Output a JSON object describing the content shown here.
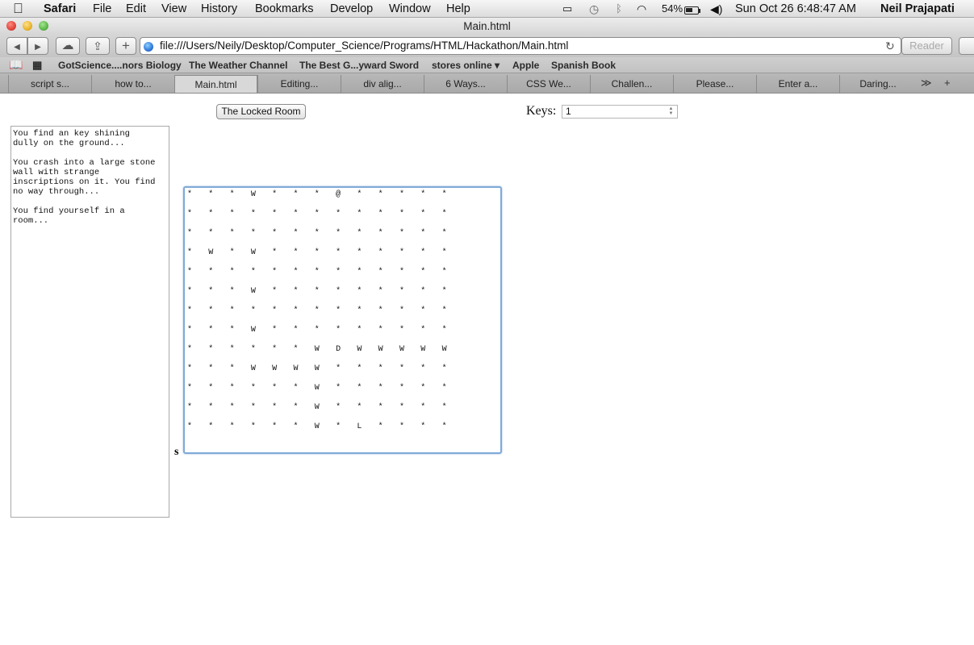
{
  "menubar": {
    "apple": "",
    "app_name": "Safari",
    "items": [
      "File",
      "Edit",
      "View",
      "History",
      "Bookmarks",
      "Develop",
      "Window",
      "Help"
    ],
    "battery": "54%",
    "datetime": "Sun Oct 26  6:48:47 AM",
    "user": "Neil Prajapati"
  },
  "window": {
    "title": "Main.html"
  },
  "toolbar": {
    "back": "◀",
    "forward": "▶",
    "icloud": "☁",
    "share": "⇪",
    "new_tab": "+",
    "url": "file:///Users/Neily/Desktop/Computer_Science/Programs/HTML/Hackathon/Main.html",
    "reload": "↻",
    "reader": "Reader"
  },
  "bookmarks": [
    "GotScience....nors Biology",
    "The Weather Channel",
    "The Best G...yward Sword",
    "stores online ▾",
    "Apple",
    "Spanish Book"
  ],
  "tabs": [
    {
      "label": "script s...",
      "active": false
    },
    {
      "label": "how to...",
      "active": false
    },
    {
      "label": "Main.html",
      "active": true
    },
    {
      "label": "Editing...",
      "active": false
    },
    {
      "label": "div alig...",
      "active": false
    },
    {
      "label": "6 Ways...",
      "active": false
    },
    {
      "label": "CSS We...",
      "active": false
    },
    {
      "label": "Challen...",
      "active": false
    },
    {
      "label": "Please...",
      "active": false
    },
    {
      "label": "Enter a...",
      "active": false
    },
    {
      "label": "Daring...",
      "active": false
    }
  ],
  "tab_controls": {
    "more": "≫",
    "add": "+"
  },
  "page": {
    "room_button": "The Locked Room",
    "keys_label": "Keys:",
    "keys_value": "1",
    "log_text": "You find an key shining\ndully on the ground...\n\nYou crash into a large stone\nwall with strange\ninscriptions on it. You find\nno way through...\n\nYou find yourself in a\nroom...",
    "side_label": "s",
    "map_rows": [
      [
        "*",
        "*",
        "*",
        "W",
        "*",
        "*",
        "*",
        "@",
        "*",
        "*",
        "*",
        "*",
        "*"
      ],
      [
        "*",
        "*",
        "*",
        "*",
        "*",
        "*",
        "*",
        "*",
        "*",
        "*",
        "*",
        "*",
        "*"
      ],
      [
        "*",
        "*",
        "*",
        "*",
        "*",
        "*",
        "*",
        "*",
        "*",
        "*",
        "*",
        "*",
        "*"
      ],
      [
        "*",
        "W",
        "*",
        "W",
        "*",
        "*",
        "*",
        "*",
        "*",
        "*",
        "*",
        "*",
        "*"
      ],
      [
        "*",
        "*",
        "*",
        "*",
        "*",
        "*",
        "*",
        "*",
        "*",
        "*",
        "*",
        "*",
        "*"
      ],
      [
        "*",
        "*",
        "*",
        "W",
        "*",
        "*",
        "*",
        "*",
        "*",
        "*",
        "*",
        "*",
        "*"
      ],
      [
        "*",
        "*",
        "*",
        "*",
        "*",
        "*",
        "*",
        "*",
        "*",
        "*",
        "*",
        "*",
        "*"
      ],
      [
        "*",
        "*",
        "*",
        "W",
        "*",
        "*",
        "*",
        "*",
        "*",
        "*",
        "*",
        "*",
        "*"
      ],
      [
        "*",
        "*",
        "*",
        "*",
        "*",
        "*",
        "W",
        "D",
        "W",
        "W",
        "W",
        "W",
        "W"
      ],
      [
        "*",
        "*",
        "*",
        "W",
        "W",
        "W",
        "W",
        "*",
        "*",
        "*",
        "*",
        "*",
        "*"
      ],
      [
        "*",
        "*",
        "*",
        "*",
        "*",
        "*",
        "W",
        "*",
        "*",
        "*",
        "*",
        "*",
        "*"
      ],
      [
        "*",
        "*",
        "*",
        "*",
        "*",
        "*",
        "W",
        "*",
        "*",
        "*",
        "*",
        "*",
        "*"
      ],
      [
        "*",
        "*",
        "*",
        "*",
        "*",
        "*",
        "W",
        "*",
        "L",
        "*",
        "*",
        "*",
        "*"
      ]
    ]
  }
}
